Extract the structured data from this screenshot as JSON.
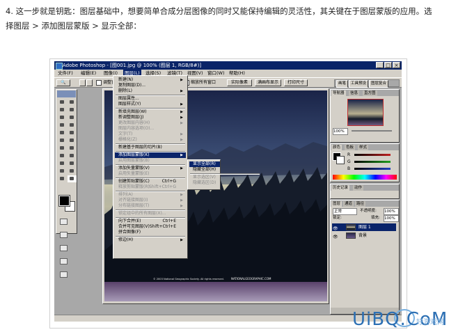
{
  "caption": {
    "line1": "4. 这一步就是钥匙：图层基础中，想要简单合成分层图像的同时又能保持编辑的灵活性，其关键在于图层蒙版的应用。选",
    "line2": "择图层 > 添加图层蒙版 > 显示全部："
  },
  "photoshop": {
    "title": "Adobe Photoshop - [图001.jpg @ 100% (图层 1, RGB/8#)]",
    "window_buttons": [
      "_",
      "□",
      "×"
    ],
    "menubar": [
      "文件(F)",
      "编辑(E)",
      "图像(I)",
      "图层(L)",
      "选择(S)",
      "滤镜(T)",
      "视图(V)",
      "窗口(W)",
      "帮助(H)"
    ],
    "active_menu_index": 3,
    "options_bar": {
      "checkbox_label": "调整窗口大小以满屏显示",
      "checkbox2_label": "缩放所有窗口",
      "btn_actual": "实际像素",
      "btn_fit": "满画布显示",
      "btn_print": "打印尺寸",
      "palette_well": [
        "画笔",
        "工具预设",
        "图层复合"
      ]
    },
    "layer_menu": [
      {
        "label": "新建(N)",
        "arrow": true
      },
      {
        "label": "复制图层(D)..."
      },
      {
        "label": "删除(L)",
        "arrow": true
      },
      {
        "sep": true
      },
      {
        "label": "图层属性..."
      },
      {
        "label": "图层样式(Y)",
        "arrow": true
      },
      {
        "sep": true
      },
      {
        "label": "新填充图层(W)",
        "arrow": true
      },
      {
        "label": "新调整图层(J)",
        "arrow": true
      },
      {
        "label": "更改图层内容(H)",
        "arrow": true,
        "disabled": true
      },
      {
        "label": "图层内容选项(O)...",
        "disabled": true
      },
      {
        "label": "文字(T)",
        "arrow": true,
        "disabled": true
      },
      {
        "label": "栅格化(Z)",
        "arrow": true,
        "disabled": true
      },
      {
        "sep": true
      },
      {
        "label": "新建基于图层的切片(B)"
      },
      {
        "sep": true
      },
      {
        "label": "添加图层蒙版(K)",
        "arrow": true,
        "highlight": true
      },
      {
        "label": "启用图层蒙版(B)",
        "disabled": true
      },
      {
        "sep": true
      },
      {
        "label": "添加矢量蒙版(V)",
        "arrow": true
      },
      {
        "label": "启用矢量蒙版(E)",
        "disabled": true
      },
      {
        "sep": true
      },
      {
        "label": "创建剪贴蒙版(C)",
        "accel": "Ctrl+G"
      },
      {
        "label": "释放剪贴蒙版(R)",
        "accel": "Shift+Ctrl+G",
        "disabled": true
      },
      {
        "sep": true
      },
      {
        "label": "排列(A)",
        "arrow": true,
        "disabled": true
      },
      {
        "label": "对齐链接图层(I)",
        "arrow": true,
        "disabled": true
      },
      {
        "label": "分布链接图层(T)",
        "arrow": true,
        "disabled": true
      },
      {
        "sep": true
      },
      {
        "label": "锁定组中的所有图层(X)...",
        "disabled": true
      },
      {
        "sep": true
      },
      {
        "label": "向下合并(E)",
        "accel": "Ctrl+E"
      },
      {
        "label": "合并可见图层(V)",
        "accel": "Shift+Ctrl+E"
      },
      {
        "label": "拼合图像(F)"
      },
      {
        "sep": true
      },
      {
        "label": "修边(H)",
        "arrow": true
      }
    ],
    "submenu": [
      {
        "label": "显示全部(R)",
        "highlight": true
      },
      {
        "label": "隐藏全部(H)"
      },
      {
        "sep": true
      },
      {
        "label": "显示选区(V)",
        "disabled": true
      },
      {
        "label": "隐藏选区(D)",
        "disabled": true
      }
    ],
    "doc_copyright": "© 2003 National Geographic Society. All rights reserved.",
    "doc_brand": "NATIONALGEOGRAPHIC.COM",
    "navigator": {
      "tabs": [
        "导航器",
        "信息",
        "直方图"
      ],
      "zoom": "100%"
    },
    "color_panel": {
      "tabs": [
        "颜色",
        "色板",
        "样式"
      ],
      "sliders": [
        {
          "label": "R",
          "value": "",
          "color": "#c02020"
        },
        {
          "label": "G",
          "value": "",
          "color": "#20a020"
        },
        {
          "label": "B",
          "value": "",
          "color": "#2040c0"
        }
      ]
    },
    "history_panel": {
      "tabs": [
        "历史记录",
        "动作"
      ]
    },
    "layers_panel": {
      "tabs": [
        "图层",
        "通道",
        "路径"
      ],
      "blend_mode": "正常",
      "opacity_label": "不透明度:",
      "opacity_value": "100%",
      "lock_label": "锁定:",
      "fill_label": "填充:",
      "fill_value": "100%",
      "layers": [
        {
          "name": "图层 1",
          "selected": true
        },
        {
          "name": "背景",
          "selected": false
        }
      ]
    }
  },
  "watermark": {
    "text": "UiBQ.CoM",
    "sub": "好游戏网"
  }
}
